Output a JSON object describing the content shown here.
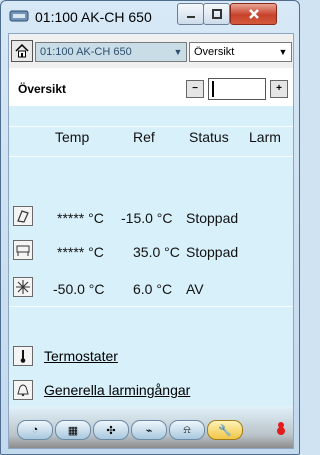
{
  "window": {
    "title": "01:100 AK-CH 650"
  },
  "toolbar": {
    "device_value": "01:100 AK-CH 650",
    "view_value": "Översikt"
  },
  "section": {
    "title": "Översikt"
  },
  "table": {
    "headers": [
      "Temp",
      "Ref",
      "Status",
      "Larm"
    ],
    "rows": [
      {
        "icon": "fridge-icon",
        "temp": "***** °C",
        "ref": "-15.0 °C",
        "status": "Stoppad"
      },
      {
        "icon": "display-case-icon",
        "temp": "***** °C",
        "ref": "35.0 °C",
        "status": "Stoppad"
      },
      {
        "icon": "snowflake-icon",
        "temp": "-50.0 °C",
        "ref": "6.0 °C",
        "status": "AV"
      }
    ]
  },
  "links": [
    {
      "label": "Termostater",
      "icon": "thermometer-icon"
    },
    {
      "label": "Generella larmingångar",
      "icon": "bell-icon"
    }
  ],
  "bottom_tabs": [
    "overview-tab",
    "grid-tab",
    "fan-tab",
    "chart-tab",
    "alarm-tab",
    "tools-tab"
  ]
}
